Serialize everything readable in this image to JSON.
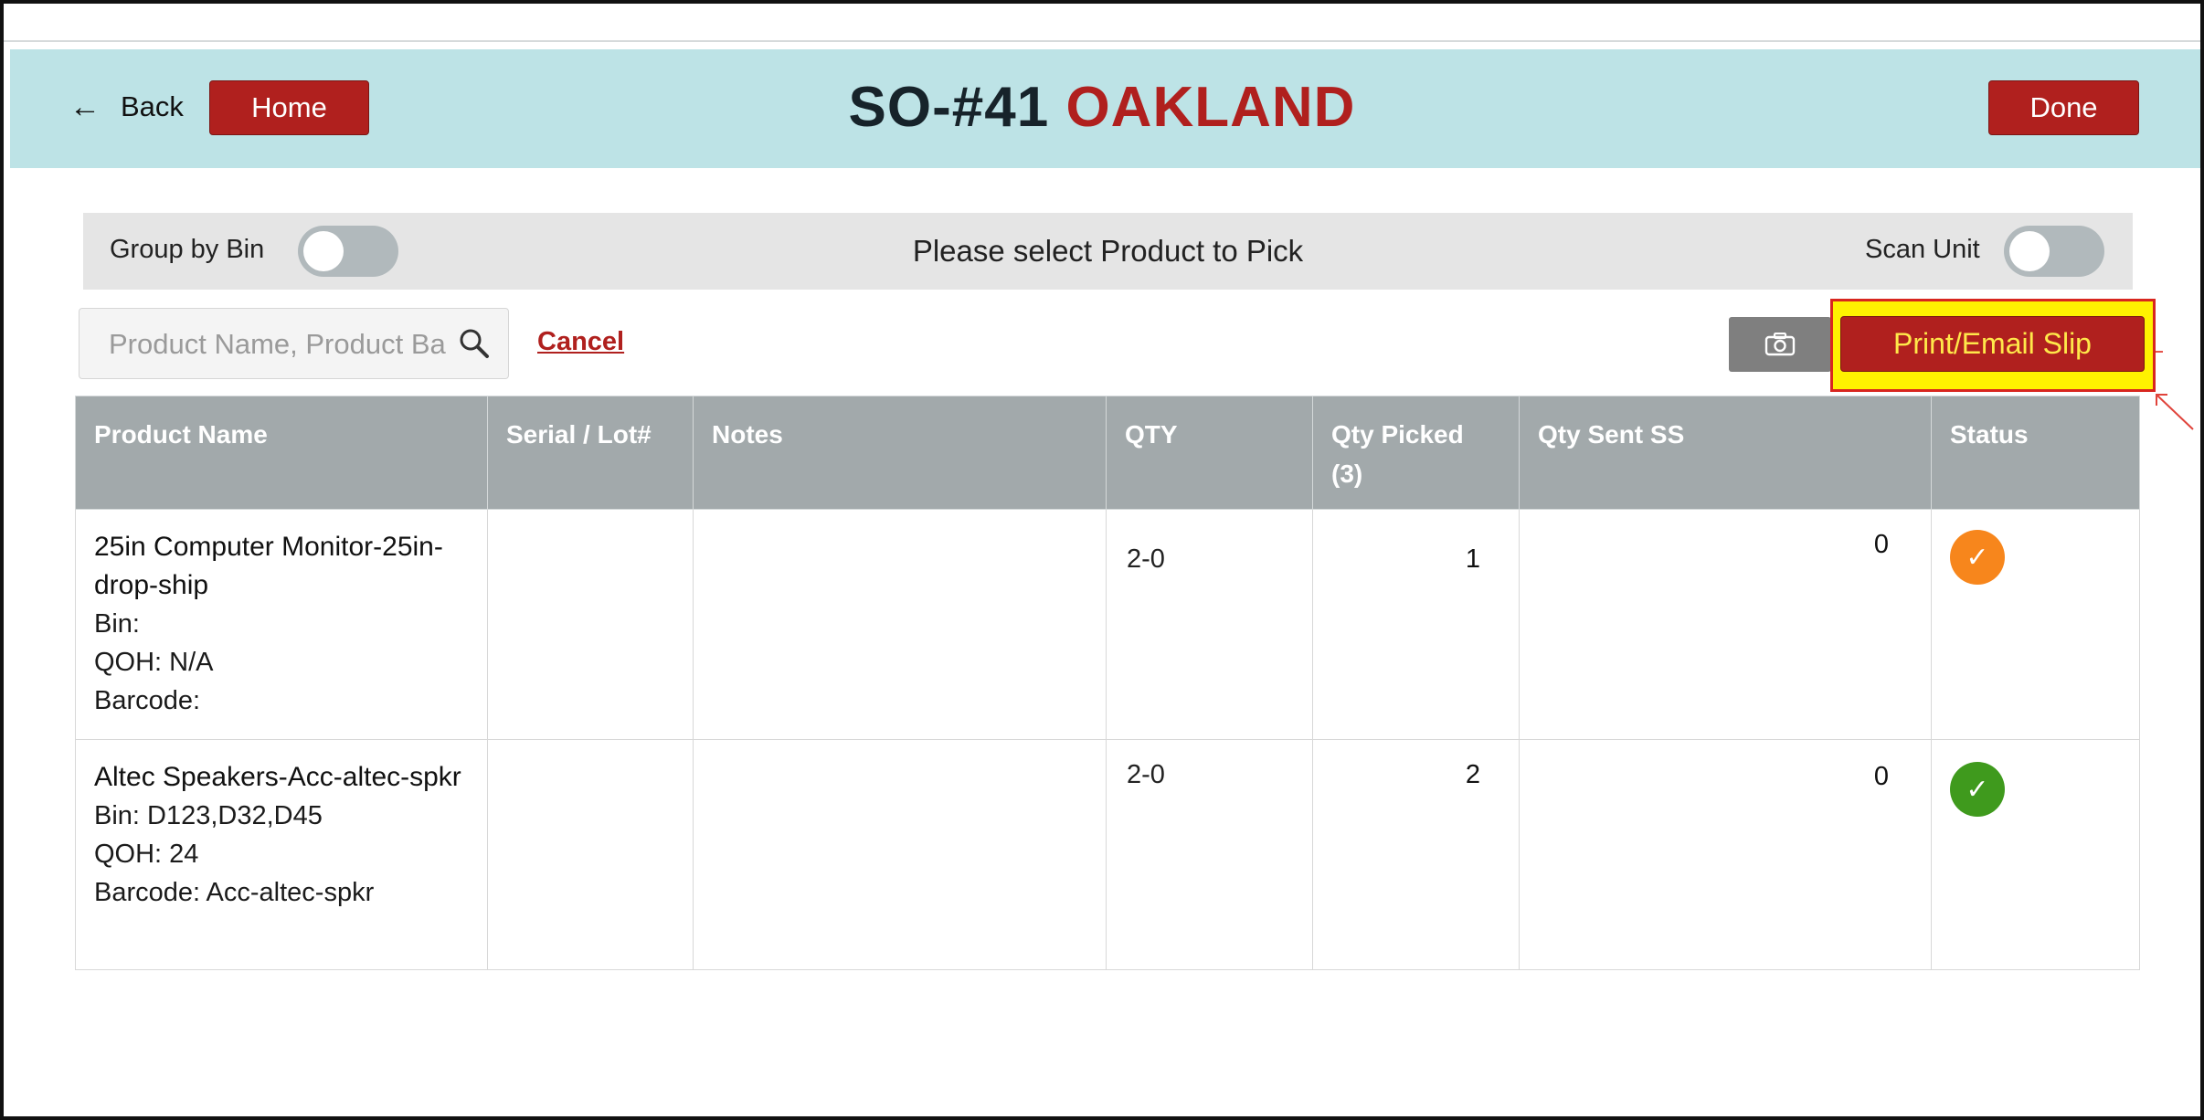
{
  "header": {
    "back_label": "Back",
    "home_label": "Home",
    "order_no": "SO-#41",
    "location": "OAKLAND",
    "done_label": "Done"
  },
  "toolbar": {
    "group_by_bin_label": "Group by Bin",
    "group_by_bin_on": false,
    "instruction": "Please select Product to Pick",
    "scan_unit_label": "Scan Unit",
    "scan_unit_on": false
  },
  "search": {
    "placeholder": "Product Name, Product Barcode",
    "cancel_label": "Cancel",
    "print_label": "Print/Email Slip"
  },
  "table": {
    "columns": {
      "product_name": "Product Name",
      "serial": "Serial / Lot#",
      "notes": "Notes",
      "qty": "QTY",
      "qty_picked": "Qty Picked",
      "qty_picked_count": "(3)",
      "qty_sent": "Qty Sent SS",
      "status": "Status"
    },
    "rows": [
      {
        "name": "25in Computer Monitor-25in-drop-ship",
        "bin": "Bin:",
        "qoh": "QOH: N/A",
        "barcode": "Barcode:",
        "serial": "",
        "notes": "",
        "qty": "2-0",
        "qty_picked": "1",
        "qty_sent": "0",
        "status_color": "#f7861c",
        "status_icon": "check-icon"
      },
      {
        "name": "Altec Speakers-Acc-altec-spkr",
        "bin": "Bin: D123,D32,D45",
        "qoh": "QOH: 24",
        "barcode": "Barcode: Acc-altec-spkr",
        "serial": "",
        "notes": "",
        "qty": "2-0",
        "qty_picked": "2",
        "qty_sent": "0",
        "status_color": "#3f9a1d",
        "status_icon": "check-icon"
      }
    ]
  },
  "colors": {
    "brand_red": "#b0201e",
    "header_bg": "#bde3e6",
    "highlight": "#fff200"
  }
}
